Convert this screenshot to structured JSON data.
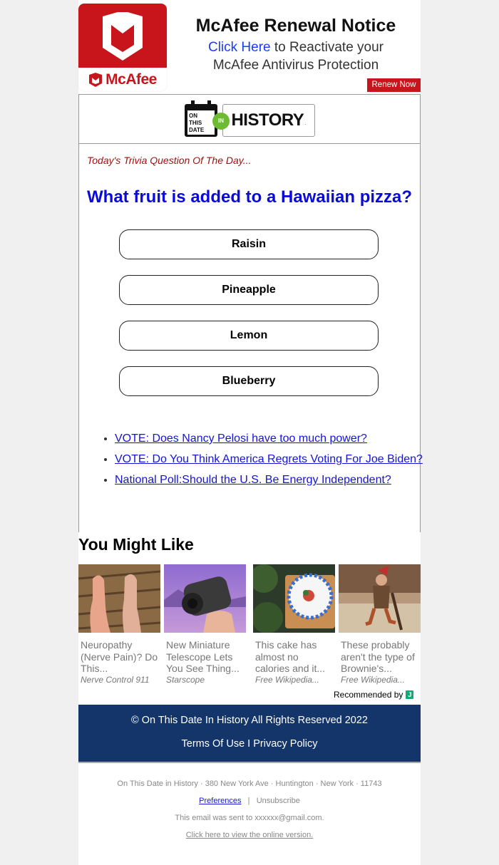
{
  "banner": {
    "brand": "McAfee",
    "title": "McAfee Renewal Notice",
    "click_here": "Click Here",
    "sub_line1_rest": " to Reactivate your",
    "sub_line2": "McAfee Antivirus Protection",
    "renew_button": "Renew Now",
    "brand_color": "#c8151c"
  },
  "logo": {
    "calendar_lines": [
      "ON",
      "THIS",
      "DATE"
    ],
    "in": "IN",
    "history": "HISTORY",
    "dot": "."
  },
  "trivia": {
    "label": "Today's Trivia Question Of The Day...",
    "question": "What fruit is added to a Hawaiian pizza?",
    "answers": [
      "Raisin",
      "Pineapple",
      "Lemon",
      "Blueberry"
    ]
  },
  "links": [
    "VOTE: Does Nancy Pelosi have too much power?",
    "VOTE: Do You Think America Regrets Voting For Joe Biden?",
    "National Poll:Should the U.S. Be Energy Independent?"
  ],
  "recommendations": {
    "title": "You Might Like",
    "items": [
      {
        "title": "Neuropathy (Nerve Pain)? Do This...",
        "source": "Nerve Control 911",
        "image": "feet-photo"
      },
      {
        "title": "New Miniature Telescope Lets You See Thing...",
        "source": "Starscope",
        "image": "monocular-photo"
      },
      {
        "title": "This cake has almost no calories and it...",
        "source": "Free Wikipedia...",
        "image": "plate-photo"
      },
      {
        "title": "These probably aren't the type of Brownie's...",
        "source": "Free Wikipedia...",
        "image": "brownie-illustration"
      }
    ],
    "recommended_by": "Recommended by",
    "rec_badge": "J"
  },
  "footer": {
    "copyright": "© On This Date In History All Rights Reserved 2022",
    "terms": "Terms Of Use",
    "sep": " I ",
    "privacy": "Privacy Policy",
    "address": "On This Date in History · 380 New York Ave · Huntington · New York · 11743",
    "preferences": "Preferences",
    "pipe": "|",
    "unsubscribe": "Unsubscribe",
    "sent_to": "This email was sent to xxxxxx@gmail.com.",
    "online_version": "Click here to view the online version.",
    "bg_color": "#14356a"
  }
}
